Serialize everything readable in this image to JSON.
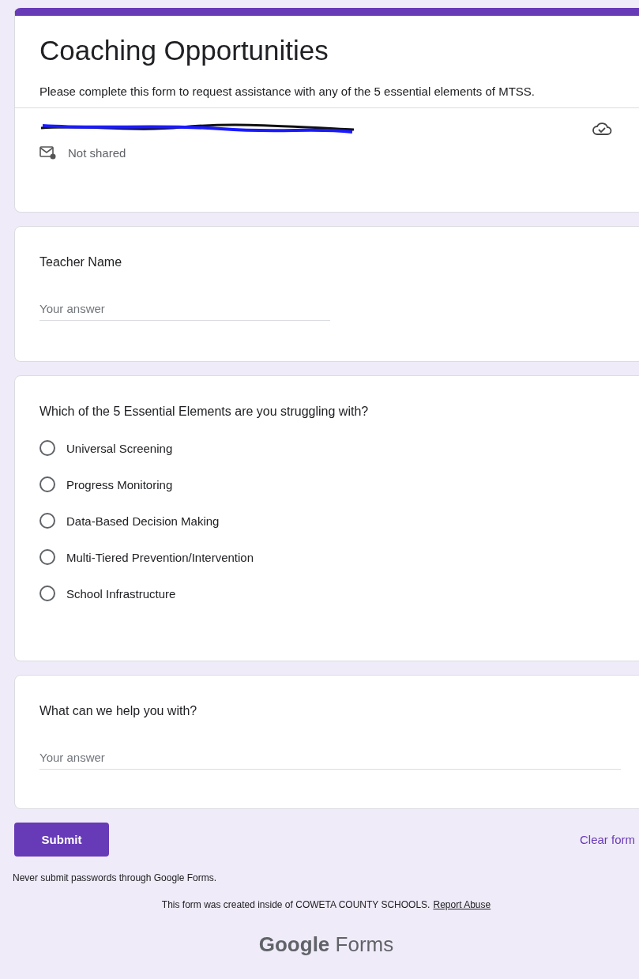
{
  "header": {
    "title": "Coaching Opportunities",
    "description": "Please complete this form to request assistance with any of the 5 essential elements of MTSS.",
    "sharing": "Not shared"
  },
  "questions": [
    {
      "kind": "text",
      "label": "Teacher Name",
      "placeholder": "Your answer"
    },
    {
      "kind": "radio",
      "label": "Which of the 5 Essential Elements are you struggling with?",
      "options": [
        {
          "label": "Universal Screening",
          "selected": false
        },
        {
          "label": "Progress Monitoring",
          "selected": false
        },
        {
          "label": "Data-Based Decision Making",
          "selected": false
        },
        {
          "label": "Multi-Tiered Prevention/Intervention",
          "selected": false
        },
        {
          "label": "School Infrastructure",
          "selected": false
        }
      ]
    },
    {
      "kind": "long",
      "label": "What can we help you with?",
      "placeholder": "Your answer"
    }
  ],
  "actions": {
    "submit": "Submit",
    "clear": "Clear form"
  },
  "footer": {
    "warning": "Never submit passwords through Google Forms.",
    "created": "This form was created inside of COWETA COUNTY SCHOOLS.",
    "report": "Report Abuse",
    "logo": "**Google** Forms"
  }
}
